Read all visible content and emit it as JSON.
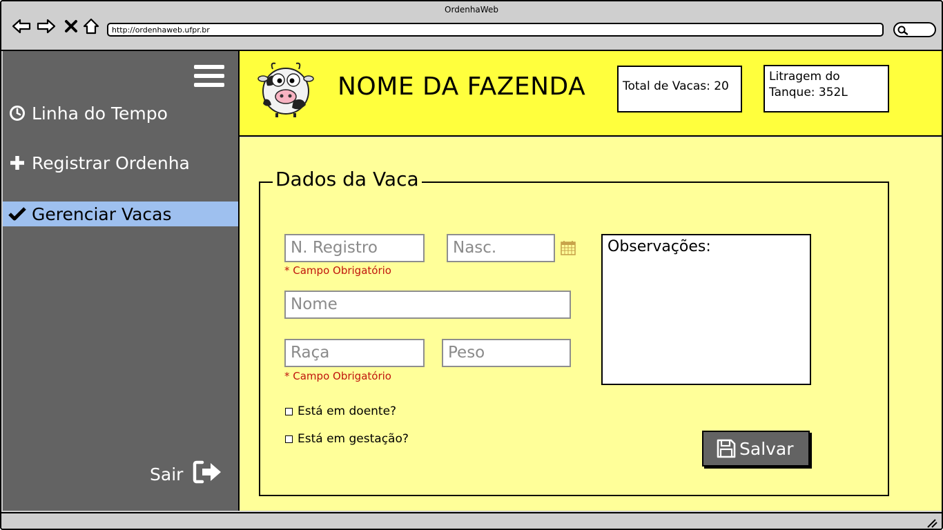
{
  "browser": {
    "window_title": "OrdenhaWeb",
    "url": "http://ordenhaweb.ufpr.br",
    "icons": [
      "back-arrow-icon",
      "forward-arrow-icon",
      "close-x-icon",
      "home-icon",
      "search-icon"
    ]
  },
  "sidebar": {
    "menu_icon": "hamburger-icon",
    "items": [
      {
        "label": "Linha do Tempo",
        "icon": "clock-icon",
        "active": false
      },
      {
        "label": "Registrar Ordenha",
        "icon": "plus-icon",
        "active": false
      },
      {
        "label": "Gerenciar Vacas",
        "icon": "check-icon",
        "active": true
      }
    ],
    "logout_label": "Sair",
    "logout_icon": "sign-out-icon"
  },
  "header": {
    "farm_name": "NOME DA FAZENDA",
    "logo": "cow-icon",
    "total_cows_label": "Total de Vacas: 20",
    "tank_label_line1": "Litragem do",
    "tank_label_line2": "Tanque: 352L"
  },
  "form": {
    "legend": "Dados da Vaca",
    "registro_placeholder": "N. Registro",
    "registro_required": "* Campo Obrigatório",
    "nasc_placeholder": "Nasc.",
    "nome_placeholder": "Nome",
    "raca_placeholder": "Raça",
    "raca_required": "* Campo Obrigatório",
    "peso_placeholder": "Peso",
    "observacoes_label": "Observações:",
    "checkbox_doente": "Está em doente?",
    "checkbox_gestacao": "Está em gestação?",
    "save_label": "Salvar"
  },
  "colors": {
    "header_bg": "#ffff3d",
    "content_bg": "#ffff99",
    "sidebar_bg": "#636363",
    "active_item_bg": "#9ec0ef",
    "required_text": "#c0140c"
  }
}
